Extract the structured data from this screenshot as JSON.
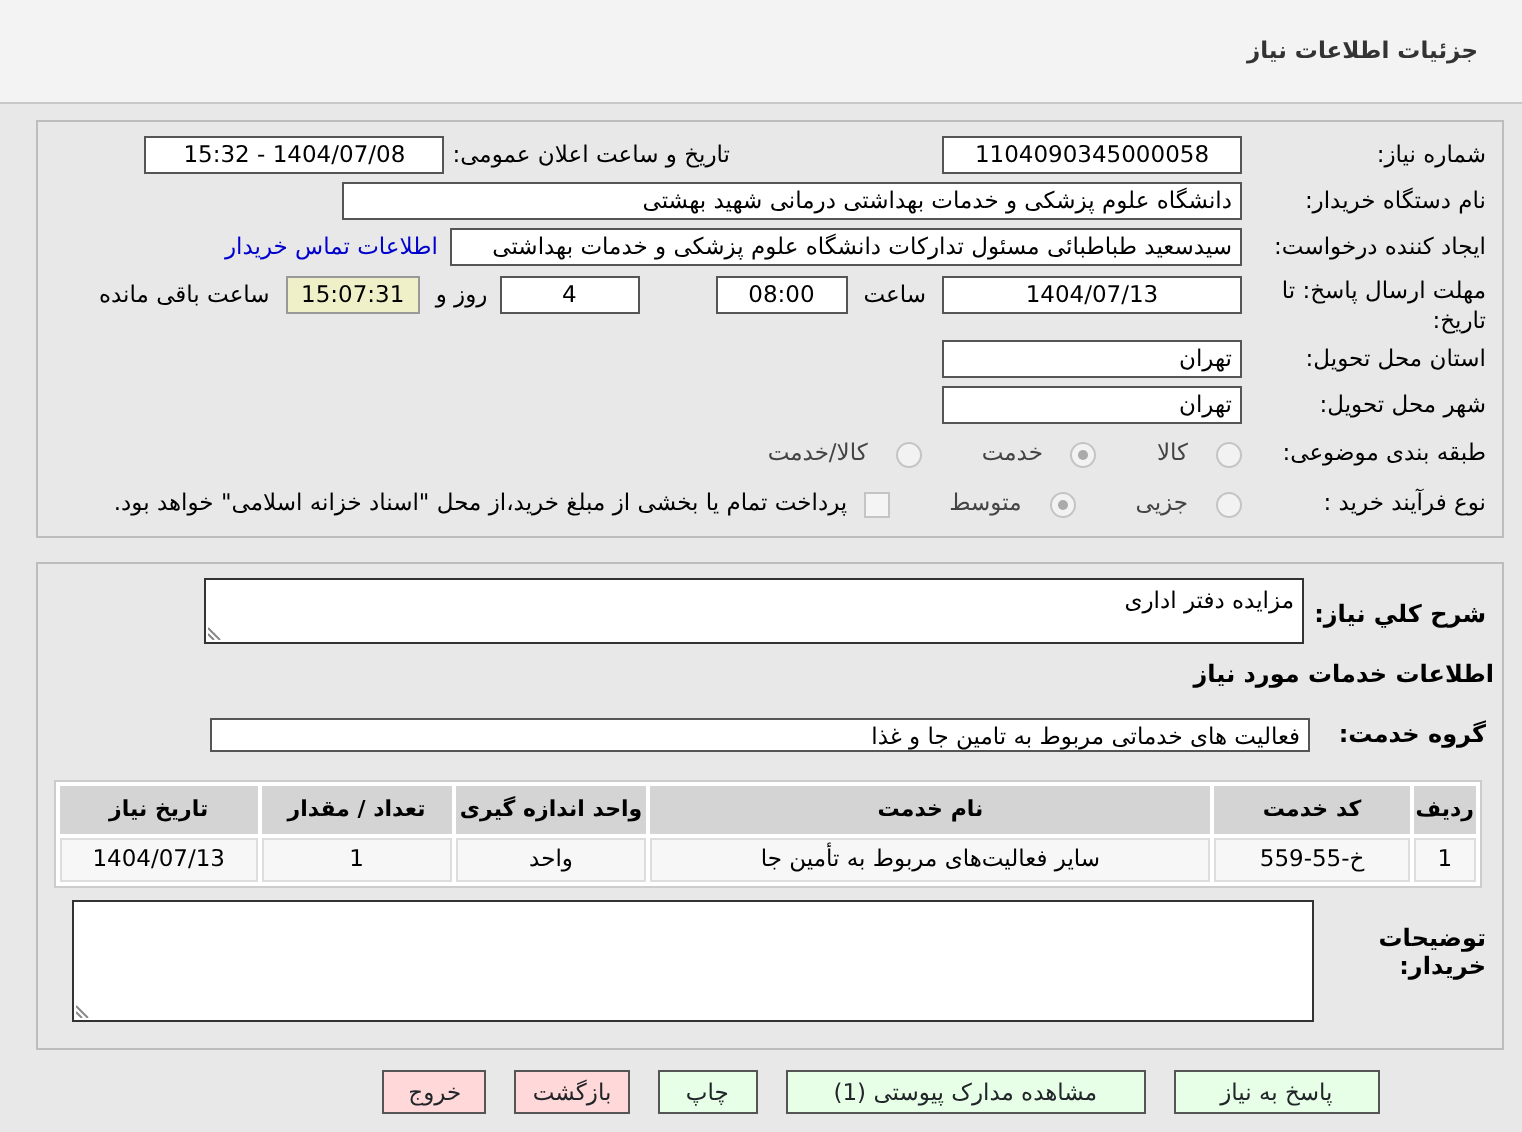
{
  "header": {
    "title": "جزئیات اطلاعات نیاز"
  },
  "need_number": {
    "label": "شماره نیاز:",
    "value": "1104090345000058"
  },
  "announce_date": {
    "label": "تاریخ و ساعت اعلان عمومی:",
    "value": "1404/07/08 - 15:32"
  },
  "buyer_org": {
    "label": "نام دستگاه خریدار:",
    "value": "دانشگاه علوم پزشکی و خدمات بهداشتی درمانی شهید بهشتی"
  },
  "requester": {
    "label": "ایجاد کننده درخواست:",
    "value": "سیدسعید طباطبائی مسئول تدارکات دانشگاه علوم پزشکی و خدمات بهداشتی",
    "link": "اطلاعات تماس خریدار"
  },
  "deadline": {
    "label": "مهلت ارسال پاسخ: تا تاریخ:",
    "date": "1404/07/13",
    "time_label": "ساعت",
    "time": "08:00",
    "days": "4",
    "days_label": "روز و",
    "remaining": "15:07:31",
    "remaining_label": "ساعت باقی مانده"
  },
  "province": {
    "label": "استان محل تحویل:",
    "value": "تهران"
  },
  "city": {
    "label": "شهر محل تحویل:",
    "value": "تهران"
  },
  "category": {
    "label": "طبقه بندی موضوعی:",
    "options": [
      {
        "label": "کالا",
        "selected": false
      },
      {
        "label": "خدمت",
        "selected": true
      },
      {
        "label": "کالا/خدمت",
        "selected": false
      }
    ]
  },
  "purchase_type": {
    "label": "نوع فرآیند خرید :",
    "options": [
      {
        "label": "جزیی",
        "selected": false
      },
      {
        "label": "متوسط",
        "selected": true
      }
    ],
    "payment": {
      "label": "پرداخت تمام یا بخشی از مبلغ خرید،از محل \"اسناد خزانه اسلامی\" خواهد بود.",
      "checked": false
    }
  },
  "description": {
    "label": "شرح کلي نياز:",
    "value": "مزایده دفتر اداری"
  },
  "services_title": "اطلاعات خدمات مورد نیاز",
  "service_group": {
    "label": "گروه خدمت:",
    "value": "فعالیت های خدماتی مربوط به تامین جا و غذا"
  },
  "table": {
    "columns": [
      "ردیف",
      "کد خدمت",
      "نام خدمت",
      "واحد اندازه گیری",
      "تعداد / مقدار",
      "تاریخ نیاز"
    ],
    "rows": [
      [
        "1",
        "خ-55-559",
        "سایر فعالیت‌های مربوط به تأمین جا",
        "واحد",
        "1",
        "1404/07/13"
      ]
    ]
  },
  "buyer_notes": {
    "label": "توضیحات خریدار:"
  },
  "buttons": [
    {
      "label": "پاسخ به نیاز",
      "color": "#e6ffe6"
    },
    {
      "label": "مشاهده مدارک پیوستی (1)",
      "color": "#e6ffe6"
    },
    {
      "label": "چاپ",
      "color": "#e6ffe6"
    },
    {
      "label": "بازگشت",
      "color": "#ffd9d9"
    },
    {
      "label": "خروج",
      "color": "#ffd9d9"
    }
  ]
}
